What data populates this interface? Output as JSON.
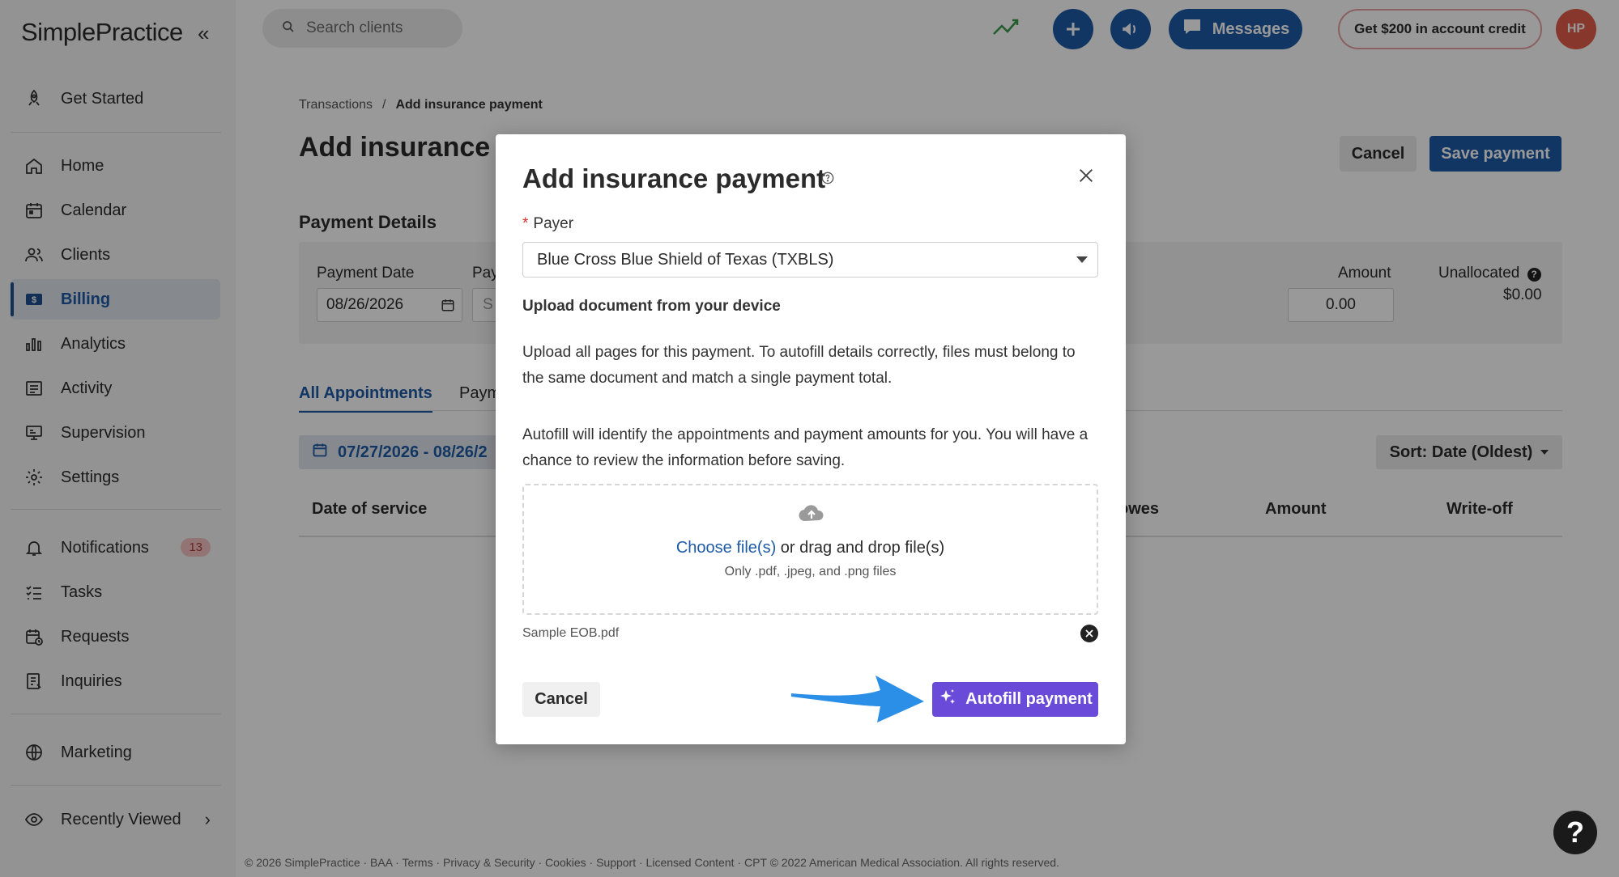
{
  "app": {
    "logo": "SimplePractice",
    "collapse_glyph": "«"
  },
  "sidebar": {
    "items": [
      {
        "label": "Get Started",
        "icon": "rocket-icon"
      },
      {
        "label": "Home",
        "icon": "home-icon"
      },
      {
        "label": "Calendar",
        "icon": "calendar-icon"
      },
      {
        "label": "Clients",
        "icon": "clients-icon"
      },
      {
        "label": "Billing",
        "icon": "billing-icon",
        "active": true
      },
      {
        "label": "Analytics",
        "icon": "analytics-icon"
      },
      {
        "label": "Activity",
        "icon": "activity-icon"
      },
      {
        "label": "Supervision",
        "icon": "supervision-icon"
      },
      {
        "label": "Settings",
        "icon": "settings-icon"
      },
      {
        "label": "Notifications",
        "icon": "bell-icon",
        "badge": "13"
      },
      {
        "label": "Tasks",
        "icon": "tasks-icon"
      },
      {
        "label": "Requests",
        "icon": "requests-icon"
      },
      {
        "label": "Inquiries",
        "icon": "inquiries-icon"
      },
      {
        "label": "Marketing",
        "icon": "globe-icon"
      },
      {
        "label": "Recently Viewed",
        "icon": "eye-icon"
      }
    ]
  },
  "topbar": {
    "search_placeholder": "Search clients",
    "messages_label": "Messages",
    "credit_label": "Get $200 in account credit",
    "avatar_initials": "HP"
  },
  "page": {
    "breadcrumb": [
      "Transactions",
      "Add insurance payment"
    ],
    "breadcrumb_sep": "/",
    "title": "Add insurance pa",
    "cancel_label": "Cancel",
    "save_label": "Save payment",
    "section_title": "Payment Details",
    "payment_date_label": "Payment Date",
    "payment_date_value": "08/26/2026",
    "payer_label_partial": "Pay",
    "payer_placeholder_partial": "S",
    "amount_label": "Amount",
    "amount_value": "0.00",
    "unallocated_label": "Unallocated",
    "unallocated_value": "$0.00",
    "tabs": [
      "All Appointments",
      "Paym"
    ],
    "date_range": "07/27/2026 - 08/26/2",
    "sort_label": "Sort: Date (Oldest)",
    "columns": [
      "Date of service",
      "owes",
      "Amount",
      "Write-off"
    ],
    "footer": "© 2026 SimplePractice · BAA · Terms · Privacy & Security · Cookies · Support · Licensed Content · CPT © 2022 American Medical Association. All rights reserved."
  },
  "modal": {
    "title": "Add insurance payment",
    "payer_required_mark": "*",
    "payer_label": "Payer",
    "payer_value": "Blue Cross Blue Shield of Texas (TXBLS)",
    "upload_title": "Upload document from your device",
    "para1": "Upload all pages for this payment. To autofill details correctly, files must belong to the same document and match a single payment total.",
    "para2": "Autofill will identify the appointments and payment amounts for you. You will have a chance to review the information before saving.",
    "choose_link": "Choose file(s)",
    "drag_text": " or drag and drop file(s)",
    "file_types": "Only .pdf, .jpeg, and .png files",
    "file_name": "Sample EOB.pdf",
    "cancel_label": "Cancel",
    "autofill_label": "Autofill payment"
  },
  "colors": {
    "primary": "#1f5aa6",
    "autofill": "#6a4ad9",
    "arrow": "#2b8fe8",
    "badge_bg": "#f3c2c2",
    "avatar": "#e35d4a"
  }
}
